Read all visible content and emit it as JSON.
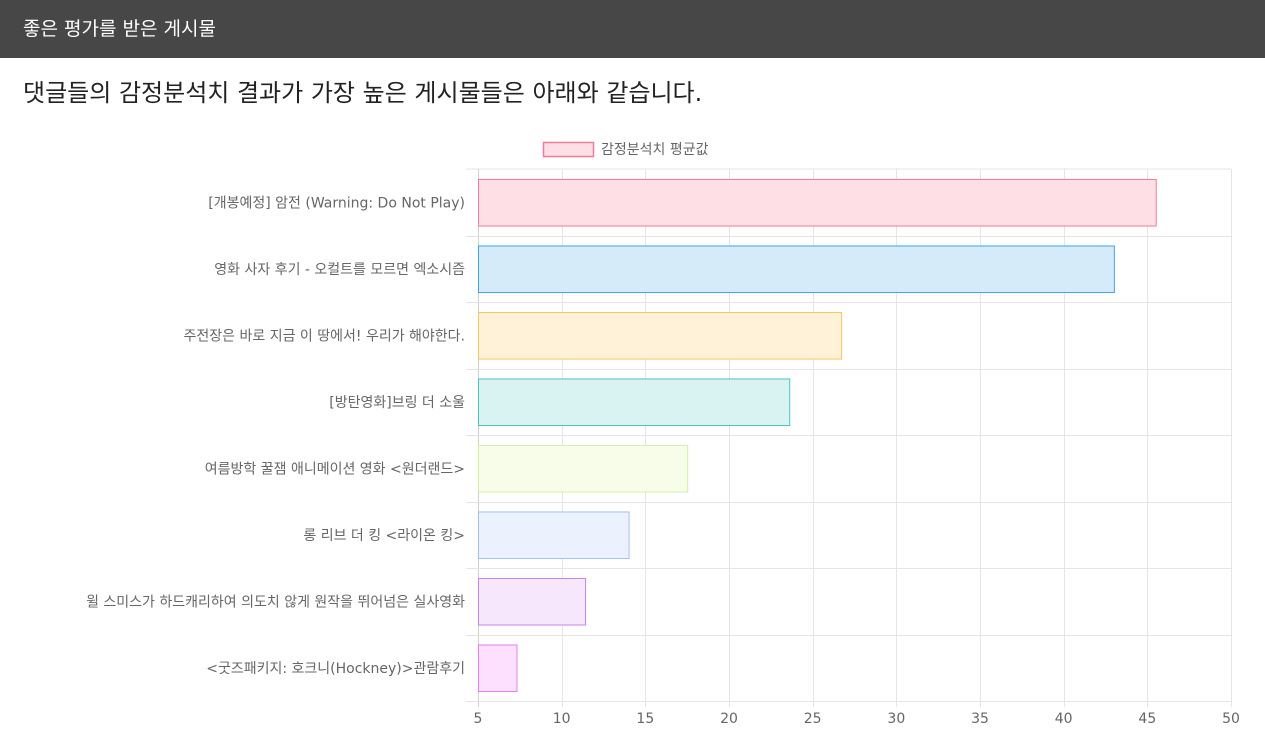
{
  "header": {
    "title": "좋은 평가를 받은 게시물"
  },
  "main": {
    "headline": "댓글들의 감정분석치 결과가 가장 높은 게시물들은 아래와 같습니다."
  },
  "chart_data": {
    "type": "bar",
    "orientation": "horizontal",
    "title": "",
    "xlabel": "",
    "ylabel": "",
    "xlim": [
      5,
      50
    ],
    "x_ticks": [
      5,
      10,
      15,
      20,
      25,
      30,
      35,
      40,
      45,
      50
    ],
    "grid": true,
    "legend_position": "top",
    "categories": [
      "[개봉예정] 암전 (Warning: Do Not Play)",
      "영화 사자 후기 - 오컬트를 모르면 엑소시즘",
      "주전장은 바로 지금 이 땅에서! 우리가 해야한다.",
      "[방탄영화]브링 더 소울",
      "여름방학 꿀잼 애니메이션 영화 <원더랜드>",
      "롱 리브 더 킹 <라이온 킹>",
      "윌 스미스가 하드캐리하여 의도치 않게 원작을 뛰어넘은 실사영화",
      "<굿즈패키지: 호크니(Hockney)>관람후기"
    ],
    "series": [
      {
        "name": "감정분석치 평균값",
        "values": [
          45.5,
          43.0,
          26.7,
          23.6,
          17.5,
          14.0,
          11.4,
          7.3
        ],
        "border_colors": [
          "#f27a9b",
          "#44a2e0",
          "#f4c85a",
          "#4cc2c0",
          "#d6f0a8",
          "#a3bff0",
          "#cc7ff0",
          "#e77df0"
        ],
        "fill_colors": [
          "#ffdfe6",
          "#d5ebf9",
          "#fff2d9",
          "#d9f2f2",
          "#f7fde8",
          "#ecf2fd",
          "#f6e7fd",
          "#fde0fd"
        ],
        "legend_border": "#f27a9b",
        "legend_fill": "#ffdfe6"
      }
    ]
  }
}
